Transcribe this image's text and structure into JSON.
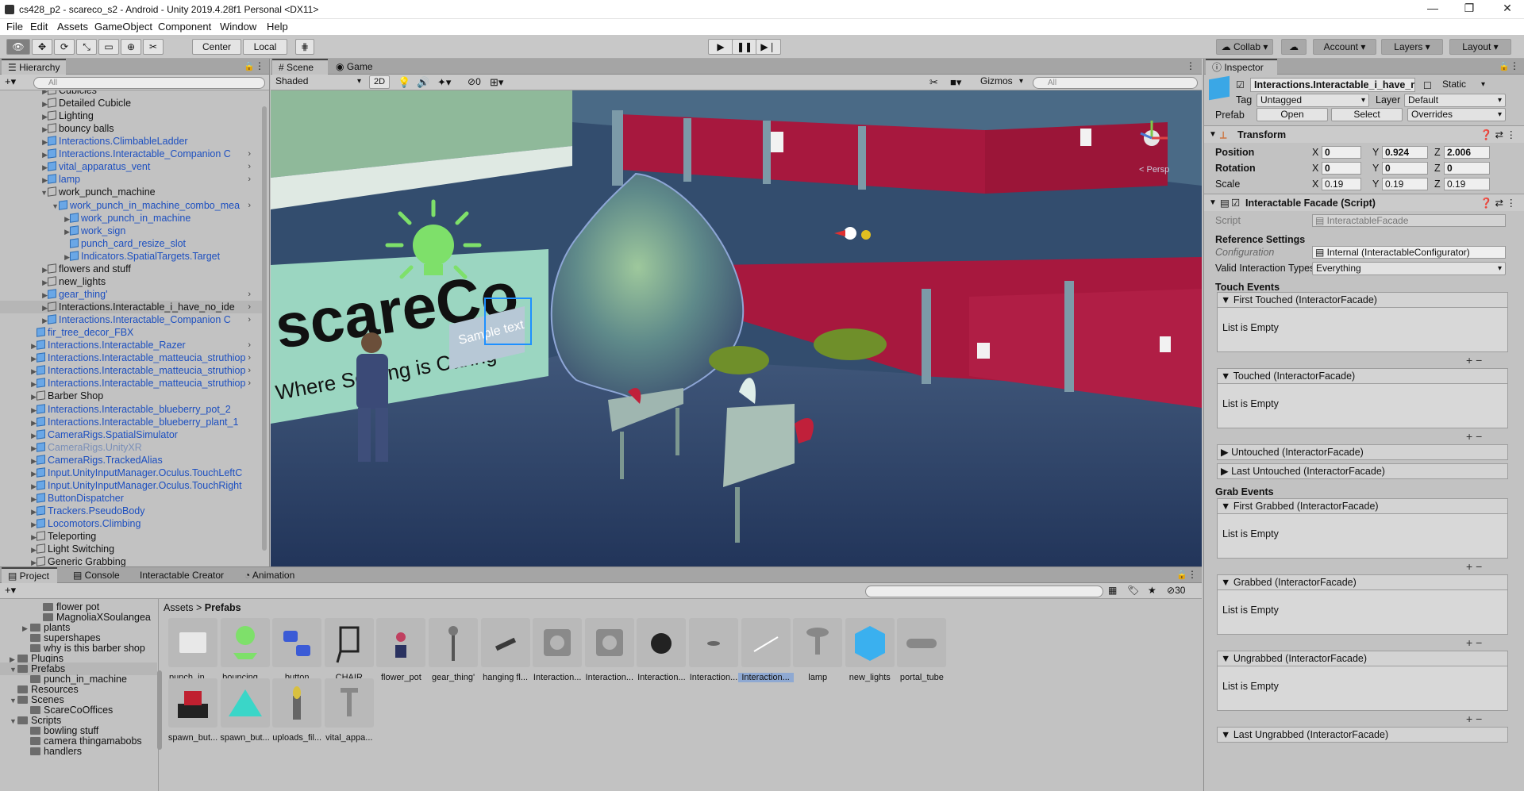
{
  "window": {
    "title": "cs428_p2 - scareco_s2 - Android - Unity 2019.4.28f1 Personal <DX11>"
  },
  "menu": [
    "File",
    "Edit",
    "Assets",
    "GameObject",
    "Component",
    "Window",
    "Help"
  ],
  "toolbar": {
    "center": "Center",
    "local": "Local",
    "collab": "Collab",
    "account": "Account",
    "layers": "Layers",
    "layout": "Layout"
  },
  "hierarchy": {
    "tab": "Hierarchy",
    "search_placeholder": "All",
    "rows": [
      {
        "label": "Cubicles",
        "style": "normal"
      },
      {
        "label": "Detailed Cubicle",
        "style": "normal"
      },
      {
        "label": "Lighting",
        "style": "normal"
      },
      {
        "label": "bouncy balls",
        "style": "normal"
      },
      {
        "label": "Interactions.ClimbableLadder",
        "style": "blue"
      },
      {
        "label": "Interactions.Interactable_Companion C",
        "style": "blue"
      },
      {
        "label": "vital_apparatus_vent",
        "style": "blue"
      },
      {
        "label": "lamp",
        "style": "blue"
      },
      {
        "label": "work_punch_machine",
        "style": "normal"
      },
      {
        "label": "work_punch_in_machine_combo_mea",
        "style": "blue"
      },
      {
        "label": "work_punch_in_machine",
        "style": "blue"
      },
      {
        "label": "work_sign",
        "style": "blue"
      },
      {
        "label": "punch_card_resize_slot",
        "style": "blue"
      },
      {
        "label": "Indicators.SpatialTargets.Target",
        "style": "blue"
      },
      {
        "label": "flowers and stuff",
        "style": "normal"
      },
      {
        "label": "new_lights",
        "style": "normal"
      },
      {
        "label": "gear_thing'",
        "style": "blue"
      },
      {
        "label": "Interactions.Interactable_i_have_no_ide",
        "style": "normal"
      },
      {
        "label": "Interactions.Interactable_Companion C",
        "style": "blue"
      },
      {
        "label": "fir_tree_decor_FBX",
        "style": "blue"
      },
      {
        "label": "Interactions.Interactable_Razer",
        "style": "blue"
      },
      {
        "label": "Interactions.Interactable_matteucia_struthiop",
        "style": "blue"
      },
      {
        "label": "Interactions.Interactable_matteucia_struthiop",
        "style": "blue"
      },
      {
        "label": "Interactions.Interactable_matteucia_struthiop",
        "style": "blue"
      },
      {
        "label": "Barber Shop",
        "style": "normal"
      },
      {
        "label": "Interactions.Interactable_blueberry_pot_2",
        "style": "blue"
      },
      {
        "label": "Interactions.Interactable_blueberry_plant_1",
        "style": "blue"
      },
      {
        "label": "CameraRigs.SpatialSimulator",
        "style": "blue"
      },
      {
        "label": "CameraRigs.UnityXR",
        "style": "grey"
      },
      {
        "label": "CameraRigs.TrackedAlias",
        "style": "blue"
      },
      {
        "label": "Input.UnityInputManager.Oculus.TouchLeftC",
        "style": "blue"
      },
      {
        "label": "Input.UnityInputManager.Oculus.TouchRight",
        "style": "blue"
      },
      {
        "label": "ButtonDispatcher",
        "style": "blue"
      },
      {
        "label": "Trackers.PseudoBody",
        "style": "blue"
      },
      {
        "label": "Locomotors.Climbing",
        "style": "blue"
      },
      {
        "label": "Teleporting",
        "style": "normal"
      },
      {
        "label": "Light Switching",
        "style": "normal"
      },
      {
        "label": "Generic Grabbing",
        "style": "normal"
      }
    ]
  },
  "scene": {
    "tabs": [
      "Scene",
      "Game"
    ],
    "shading": "Shaded",
    "mode_2d": "2D",
    "fx_count": "0",
    "gizmos": "Gizmos",
    "search_placeholder": "All",
    "persp": "< Persp",
    "billboard_logo": "scareCo",
    "billboard_tagline": "Where Scaring is Caring",
    "sample_text": "Sample text"
  },
  "inspector": {
    "tab": "Inspector",
    "object_name": "Interactions.Interactable_i_have_no",
    "static": "Static",
    "tag_label": "Tag",
    "tag_value": "Untagged",
    "layer_label": "Layer",
    "layer_value": "Default",
    "prefab_label": "Prefab",
    "prefab_open": "Open",
    "prefab_select": "Select",
    "prefab_overrides": "Overrides",
    "transform": {
      "title": "Transform",
      "position": {
        "label": "Position",
        "x": "0",
        "y": "0.924",
        "z": "2.006"
      },
      "rotation": {
        "label": "Rotation",
        "x": "0",
        "y": "0",
        "z": "0"
      },
      "scale": {
        "label": "Scale",
        "x": "0.19",
        "y": "0.19",
        "z": "0.19"
      }
    },
    "facade": {
      "title": "Interactable Facade (Script)",
      "script_label": "Script",
      "script_value": "InteractableFacade",
      "ref_settings": "Reference Settings",
      "config_label": "Configuration",
      "config_value": "Internal (InteractableConfigurator)",
      "valid_label": "Valid Interaction Types",
      "valid_value": "Everything"
    },
    "touch_events": "Touch Events",
    "grab_events": "Grab Events",
    "events": [
      {
        "name": "First Touched (InteractorFacade)",
        "body": "List is Empty"
      },
      {
        "name": "Touched (InteractorFacade)",
        "body": "List is Empty"
      },
      {
        "name": "Untouched (InteractorFacade)"
      },
      {
        "name": "Last Untouched (InteractorFacade)"
      },
      {
        "name": "First Grabbed (InteractorFacade)",
        "body": "List is Empty"
      },
      {
        "name": "Grabbed (InteractorFacade)",
        "body": "List is Empty"
      },
      {
        "name": "Ungrabbed (InteractorFacade)",
        "body": "List is Empty"
      },
      {
        "name": "Last Ungrabbed (InteractorFacade)"
      }
    ]
  },
  "project": {
    "tabs": [
      "Project",
      "Console",
      "Interactable Creator",
      "Animation"
    ],
    "count": "30",
    "breadcrumb": [
      "Assets",
      "Prefabs"
    ],
    "tree": [
      {
        "label": "flower pot",
        "indent": 3
      },
      {
        "label": "MagnoliaXSoulangea",
        "indent": 3
      },
      {
        "label": "plants",
        "indent": 2
      },
      {
        "label": "supershapes",
        "indent": 2
      },
      {
        "label": "why is this barber shop",
        "indent": 2
      },
      {
        "label": "Plugins",
        "indent": 1
      },
      {
        "label": "Prefabs",
        "indent": 1
      },
      {
        "label": "punch_in_machine",
        "indent": 2
      },
      {
        "label": "Resources",
        "indent": 1
      },
      {
        "label": "Scenes",
        "indent": 1
      },
      {
        "label": "ScareCoOffices",
        "indent": 2
      },
      {
        "label": "Scripts",
        "indent": 1
      },
      {
        "label": "bowling stuff",
        "indent": 2
      },
      {
        "label": "camera thingamabobs",
        "indent": 2
      },
      {
        "label": "handlers",
        "indent": 2
      }
    ],
    "assets": [
      {
        "label": "punch_in_...",
        "kind": "folder"
      },
      {
        "label": "bouncing ...",
        "kind": "bulb"
      },
      {
        "label": "button",
        "kind": "nodes"
      },
      {
        "label": "CHAIR",
        "kind": "chair"
      },
      {
        "label": "flower_pot",
        "kind": "pot"
      },
      {
        "label": "gear_thing'",
        "kind": "gear"
      },
      {
        "label": "hanging fl...",
        "kind": "hang"
      },
      {
        "label": "Interaction...",
        "kind": "companion"
      },
      {
        "label": "Interaction...",
        "kind": "companion"
      },
      {
        "label": "Interaction...",
        "kind": "drop"
      },
      {
        "label": "Interaction...",
        "kind": "small"
      },
      {
        "label": "Interaction...",
        "kind": "line"
      },
      {
        "label": "lamp",
        "kind": "lamp"
      },
      {
        "label": "new_lights",
        "kind": "cube"
      },
      {
        "label": "portal_tube",
        "kind": "tube"
      },
      {
        "label": "spawn_but...",
        "kind": "spawnbtn"
      },
      {
        "label": "spawn_but...",
        "kind": "triangle"
      },
      {
        "label": "uploads_fil...",
        "kind": "vase"
      },
      {
        "label": "vital_appa...",
        "kind": "vent"
      }
    ]
  },
  "colors": {
    "selection": "#b6b6b6",
    "prefab_blue": "#1c4fc0",
    "accent_green": "#7ee06a",
    "wall_red": "#a7183e"
  }
}
